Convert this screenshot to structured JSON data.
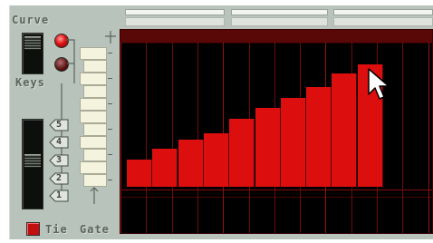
{
  "labels": {
    "curve": "Curve",
    "keys": "Keys",
    "tie": "Tie",
    "gate": "Gate"
  },
  "octave_buttons": [
    "5",
    "4",
    "3",
    "2",
    "1"
  ],
  "curve_values": [
    0.27,
    0.38,
    0.47,
    0.54,
    0.68,
    0.79,
    0.89,
    1.0,
    1.14,
    1.23
  ],
  "pointer": "arrow-cursor-icon",
  "colors": {
    "panel": "#b8c4bb",
    "bar": "#dd0e0e",
    "grid_bg": "#000000",
    "led_on": "#e01212"
  }
}
